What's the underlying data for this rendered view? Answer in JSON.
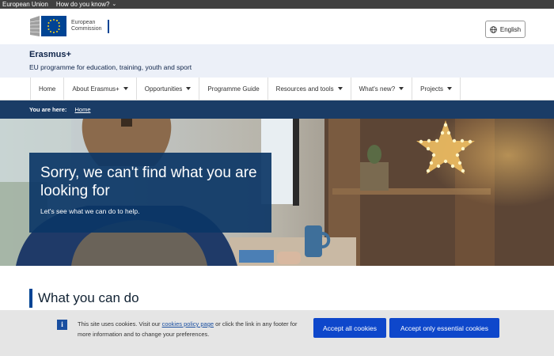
{
  "topbar": {
    "eu_label": "European Union",
    "know_label": "How do you know?"
  },
  "header": {
    "logo_text": "European Commission",
    "language_label": "English"
  },
  "site": {
    "title": "Erasmus+",
    "subtitle": "EU programme for education, training, youth and sport"
  },
  "nav": {
    "items": [
      {
        "label": "Home"
      },
      {
        "label": "About Erasmus+"
      },
      {
        "label": "Opportunities"
      },
      {
        "label": "Programme Guide"
      },
      {
        "label": "Resources and tools"
      },
      {
        "label": "What's new?"
      },
      {
        "label": "Projects"
      }
    ]
  },
  "breadcrumb": {
    "prefix": "You are here:",
    "home": "Home"
  },
  "hero": {
    "title": "Sorry, we can't find what you are looking for",
    "text": "Let's see what we can do to help."
  },
  "section": {
    "title": "What you can do"
  },
  "cookie": {
    "text_before": "This site uses cookies. Visit our ",
    "link": "cookies policy page",
    "text_after": " or click the link in any footer for more information and to change your preferences.",
    "accept_all": "Accept all cookies",
    "accept_essential": "Accept only essential cookies"
  },
  "colors": {
    "accent": "#004494",
    "button": "#0e47cb",
    "breadcrumb_bg": "#1a3c66"
  }
}
